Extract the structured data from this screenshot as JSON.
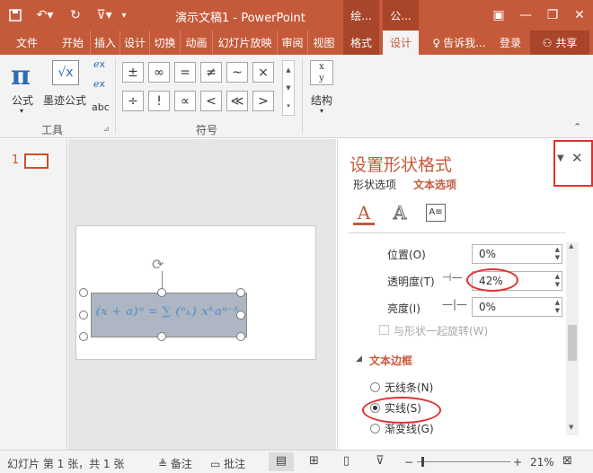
{
  "titlebar": {
    "title": "演示文稿1 - PowerPoint",
    "context_tab_1": "绘...",
    "context_tab_2": "公...",
    "qa_save_icon": "save-icon",
    "qa_undo_icon": "undo-icon",
    "qa_redo_icon": "redo-icon",
    "qa_slideshow_icon": "slideshow-icon"
  },
  "tabs": {
    "file": "文件",
    "home": "开始",
    "insert": "插入",
    "design": "设计",
    "transitions": "切换",
    "animations": "动画",
    "slideshow": "幻灯片放映",
    "review": "审阅",
    "view": "视图",
    "format": "格式",
    "eq_design": "设计",
    "tellme": "告诉我...",
    "login": "登录",
    "share": "共享"
  },
  "ribbon": {
    "equation_label": "公式",
    "ink_label": "墨迹公式",
    "abc_label": "abc",
    "tools_group": "工具",
    "symbols_group": "符号",
    "structures_label": "结构",
    "symbols": [
      "±",
      "∞",
      "=",
      "≠",
      "~",
      "×",
      "÷",
      "!",
      "∝",
      "<",
      "≪",
      ">"
    ]
  },
  "slides": {
    "number": "1",
    "thumb_text": "- -"
  },
  "equation": "(x + a)ⁿ = ∑ (ⁿₖ) xᵏaⁿ⁻ᵏ",
  "format_pane": {
    "title": "设置形状格式",
    "tab_shape": "形状选项",
    "tab_text": "文本选项",
    "position_label": "位置(O)",
    "position_value": "0%",
    "transparency_label": "透明度(T)",
    "transparency_value": "42%",
    "brightness_label": "亮度(I)",
    "brightness_value": "0%",
    "rotate_label": "与形状一起旋转(W)",
    "section_title": "文本边框",
    "radio_none": "无线条(N)",
    "radio_solid": "实线(S)",
    "radio_gradient": "渐变线(G)"
  },
  "statusbar": {
    "slide_info": "幻灯片 第 1 张，共 1 张",
    "notes": "备注",
    "comments": "批注",
    "zoom": "21%"
  },
  "colors": {
    "accent": "#c55a3b",
    "context": "#a8452a",
    "highlight_red": "#e03131"
  }
}
